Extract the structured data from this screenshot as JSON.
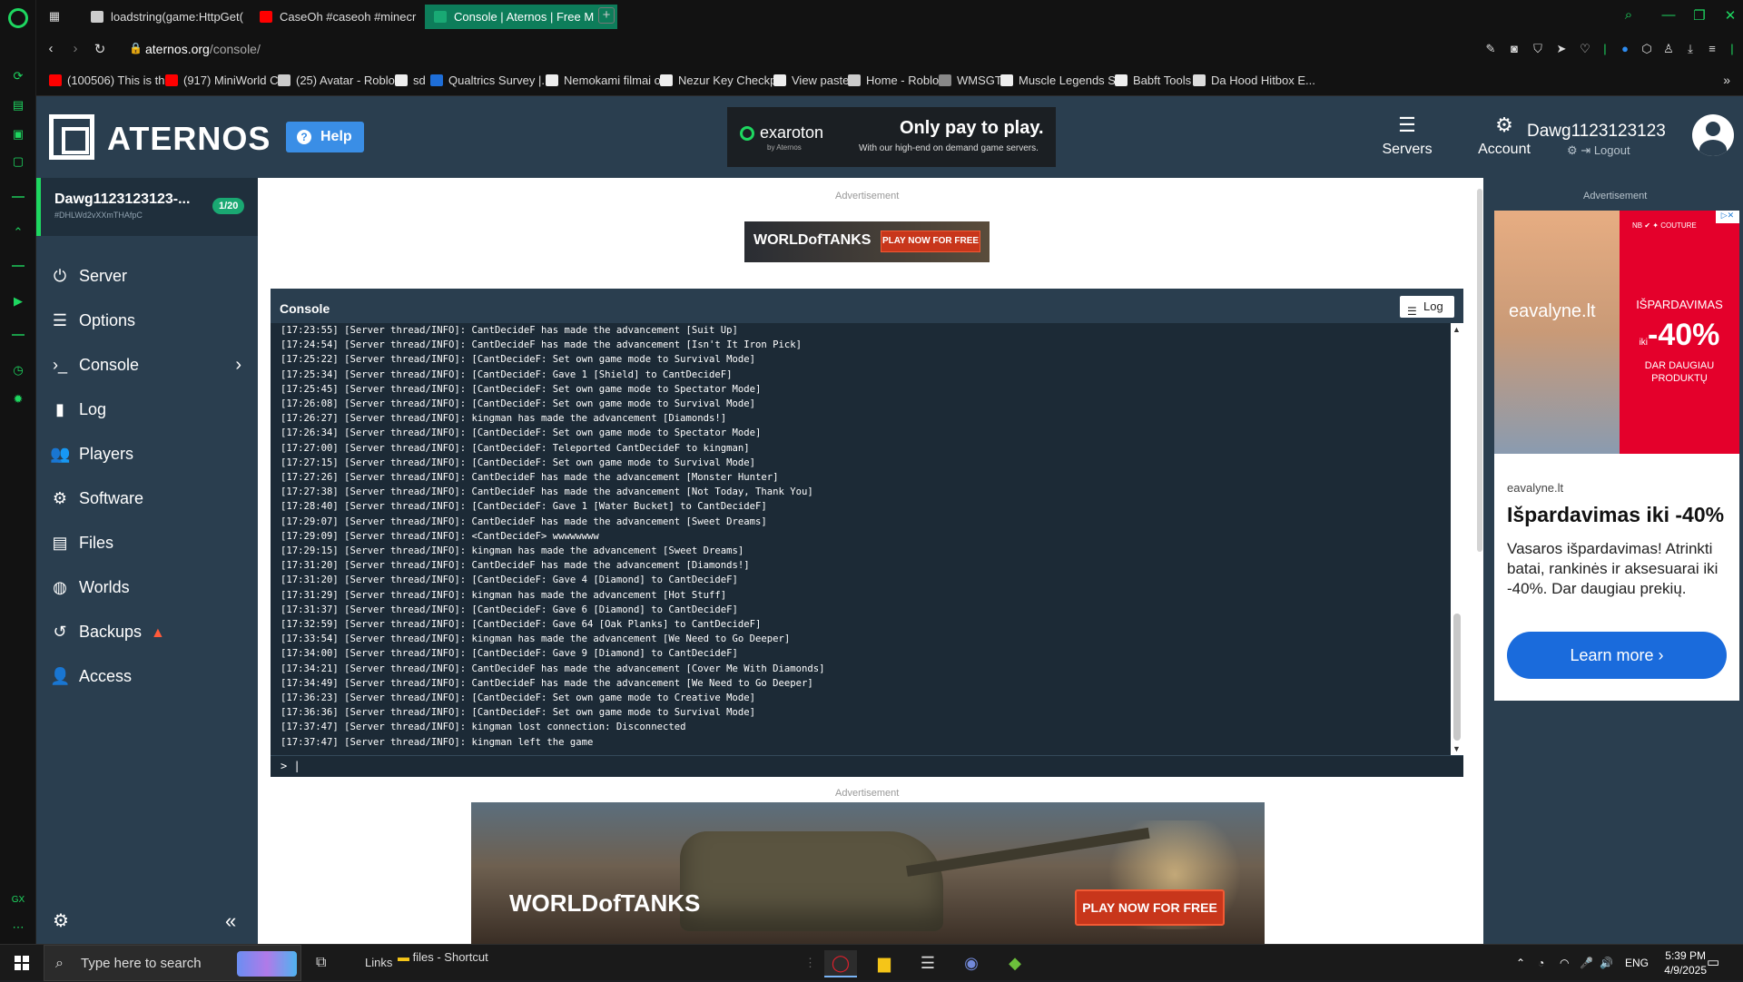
{
  "browser": {
    "tabs": [
      {
        "label": "loadstring(game:HttpGet(",
        "favicon_color": "#cccccc"
      },
      {
        "label": "CaseOh #caseoh #minecr",
        "favicon_color": "#ff0000"
      },
      {
        "label": "Console | Aternos | Free M",
        "favicon_color": "#19a974"
      }
    ],
    "url_host": "aternos.org",
    "url_path": "/console/",
    "bookmarks": [
      {
        "label": "(100506) This is th...",
        "color": "#ff0000"
      },
      {
        "label": "(917) MiniWorld C...",
        "color": "#ff0000"
      },
      {
        "label": "(25) Avatar - Roblox",
        "color": "#cccccc"
      },
      {
        "label": "sd",
        "color": "#eeeeee"
      },
      {
        "label": "Qualtrics Survey |...",
        "color": "#1e6ed8"
      },
      {
        "label": "Nemokami filmai o...",
        "color": "#eeeeee"
      },
      {
        "label": "Nezur Key Checkp...",
        "color": "#eeeeee"
      },
      {
        "label": "View paste",
        "color": "#eeeeee"
      },
      {
        "label": "Home - Roblox",
        "color": "#cccccc"
      },
      {
        "label": "WMSGT",
        "color": "#888888"
      },
      {
        "label": "Muscle Legends S...",
        "color": "#eeeeee"
      },
      {
        "label": "Babft Tools",
        "color": "#eeeeee"
      },
      {
        "label": "Da Hood Hitbox E...",
        "color": "#dddddd"
      }
    ]
  },
  "header": {
    "logo_text": "ATERNOS",
    "help_label": "Help",
    "ad_brand": "exaroton",
    "ad_brand_sub": "by Aternos",
    "ad_headline": "Only pay to play.",
    "ad_sub": "With our high-end on demand game servers.",
    "nav_servers": "Servers",
    "nav_account": "Account",
    "username": "Dawg1123123123",
    "logout": "Logout"
  },
  "sidebar": {
    "server_name": "Dawg1123123123-...",
    "server_id": "#DHLWd2vXXmTHAfpC",
    "server_badge": "1/20",
    "items": [
      {
        "label": "Server",
        "icon": "power-icon"
      },
      {
        "label": "Options",
        "icon": "options-icon"
      },
      {
        "label": "Console",
        "icon": "console-icon"
      },
      {
        "label": "Log",
        "icon": "log-icon"
      },
      {
        "label": "Players",
        "icon": "players-icon"
      },
      {
        "label": "Software",
        "icon": "software-icon"
      },
      {
        "label": "Files",
        "icon": "files-icon"
      },
      {
        "label": "Worlds",
        "icon": "worlds-icon"
      },
      {
        "label": "Backups",
        "icon": "backups-icon"
      },
      {
        "label": "Access",
        "icon": "access-icon"
      }
    ]
  },
  "main": {
    "ad_label": "Advertisement",
    "wot_small_logo": "WORLDofTANKS",
    "wot_small_btn": "PLAY NOW FOR FREE",
    "console_title": "Console",
    "log_button": "Log",
    "console_lines": [
      "[17:23:55] [Server thread/INFO]: CantDecideF has made the advancement [Suit Up]",
      "[17:24:54] [Server thread/INFO]: CantDecideF has made the advancement [Isn't It Iron Pick]",
      "[17:25:22] [Server thread/INFO]: [CantDecideF: Set own game mode to Survival Mode]",
      "[17:25:34] [Server thread/INFO]: [CantDecideF: Gave 1 [Shield] to CantDecideF]",
      "[17:25:45] [Server thread/INFO]: [CantDecideF: Set own game mode to Spectator Mode]",
      "[17:26:08] [Server thread/INFO]: [CantDecideF: Set own game mode to Survival Mode]",
      "[17:26:27] [Server thread/INFO]: kingman has made the advancement [Diamonds!]",
      "[17:26:34] [Server thread/INFO]: [CantDecideF: Set own game mode to Spectator Mode]",
      "[17:27:00] [Server thread/INFO]: [CantDecideF: Teleported CantDecideF to kingman]",
      "[17:27:15] [Server thread/INFO]: [CantDecideF: Set own game mode to Survival Mode]",
      "[17:27:26] [Server thread/INFO]: CantDecideF has made the advancement [Monster Hunter]",
      "[17:27:38] [Server thread/INFO]: CantDecideF has made the advancement [Not Today, Thank You]",
      "[17:28:40] [Server thread/INFO]: [CantDecideF: Gave 1 [Water Bucket] to CantDecideF]",
      "[17:29:07] [Server thread/INFO]: CantDecideF has made the advancement [Sweet Dreams]",
      "[17:29:09] [Server thread/INFO]: <CantDecideF> wwwwwwww",
      "[17:29:15] [Server thread/INFO]: kingman has made the advancement [Sweet Dreams]",
      "[17:31:20] [Server thread/INFO]: CantDecideF has made the advancement [Diamonds!]",
      "[17:31:20] [Server thread/INFO]: [CantDecideF: Gave 4 [Diamond] to CantDecideF]",
      "[17:31:29] [Server thread/INFO]: kingman has made the advancement [Hot Stuff]",
      "[17:31:37] [Server thread/INFO]: [CantDecideF: Gave 6 [Diamond] to CantDecideF]",
      "[17:32:59] [Server thread/INFO]: [CantDecideF: Gave 64 [Oak Planks] to CantDecideF]",
      "[17:33:54] [Server thread/INFO]: kingman has made the advancement [We Need to Go Deeper]",
      "[17:34:00] [Server thread/INFO]: [CantDecideF: Gave 9 [Diamond] to CantDecideF]",
      "[17:34:21] [Server thread/INFO]: CantDecideF has made the advancement [Cover Me With Diamonds]",
      "[17:34:49] [Server thread/INFO]: CantDecideF has made the advancement [We Need to Go Deeper]",
      "[17:36:23] [Server thread/INFO]: [CantDecideF: Set own game mode to Creative Mode]",
      "[17:36:36] [Server thread/INFO]: [CantDecideF: Set own game mode to Survival Mode]",
      "[17:37:47] [Server thread/INFO]: kingman lost connection: Disconnected",
      "[17:37:47] [Server thread/INFO]: kingman left the game"
    ],
    "console_prompt": ">",
    "wot_big_logo": "WORLDofTANKS",
    "wot_big_btn": "PLAY NOW FOR FREE"
  },
  "right_ad": {
    "ad_label": "Advertisement",
    "photo_brand": "eavalyne.lt",
    "sale_line1": "IŠPARDAVIMAS",
    "sale_prefix": "iki",
    "sale_pct": "-40%",
    "sale_line3": "DAR DAUGIAU PRODUKTŲ",
    "site": "eavalyne.lt",
    "title": "Išpardavimas iki -40%",
    "description": "Vasaros išpardavimas! Atrinkti batai, rankinės ir aksesuarai iki -40%. Dar daugiau prekių.",
    "cta": "Learn more"
  },
  "taskbar": {
    "search_placeholder": "Type here to search",
    "links_label": "Links",
    "shortcut_label": "files - Shortcut",
    "lang": "ENG",
    "time": "5:39 PM",
    "date": "4/9/2025"
  }
}
